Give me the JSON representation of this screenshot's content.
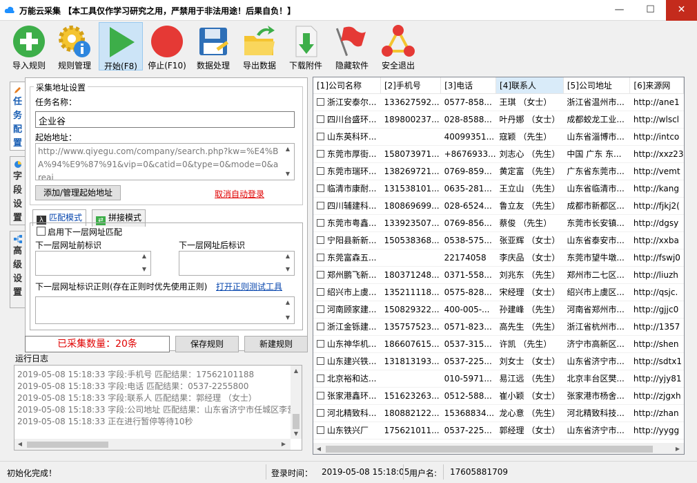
{
  "window": {
    "title": "万能云采集 【本工具仅作学习研究之用，严禁用于非法用途！后果自负！】",
    "minimize": "—",
    "maximize": "☐",
    "close": "✕"
  },
  "toolbar": {
    "import_rules": "导入规则",
    "rule_manage": "规则管理",
    "start": "开始(F8)",
    "stop": "停止(F10)",
    "data_process": "数据处理",
    "export_data": "导出数据",
    "download_attachments": "下载附件",
    "hide_software": "隐藏软件",
    "safe_exit": "安全退出"
  },
  "side_tabs": {
    "task_config": "任务配置",
    "field_settings": "字段设置",
    "advanced_settings": "高级设置"
  },
  "task_config": {
    "group_title": "采集地址设置",
    "task_name_label": "任务名称：",
    "task_name_value": "企业谷",
    "start_url_label": "起始地址：",
    "start_url_value": "http://www.qiyegu.com/company/search.php?kw=%E4%BA%94%E9%87%91&vip=0&catid=0&type=0&mode=0&areai",
    "add_manage_url_button": "添加/管理起始地址",
    "cancel_auto_login_link": "取消自动登录",
    "match_mode_tab": "匹配模式",
    "splice_mode_tab": "拼接模式",
    "enable_next_level_checkbox": "启用下一层网址匹配",
    "next_prefix_label": "下一层网址前标识",
    "next_suffix_label": "下一层网址后标识",
    "next_regex_label": "下一层网址标识正则(存在正则时优先使用正则)",
    "open_regex_tool_link": "打开正则测试工具"
  },
  "actions": {
    "collected_count": "已采集数量：20条",
    "save_rule": "保存规则",
    "new_rule": "新建规则"
  },
  "log": {
    "title": "运行日志",
    "lines": [
      "2019-05-08 15:18:33 字段:手机号 匹配结果：17562101188",
      "2019-05-08 15:18:33 字段:电话 匹配结果：0537-2255800",
      "2019-05-08 15:18:33 字段:联系人 匹配结果：郭经理 （女士）",
      "2019-05-08 15:18:33 字段:公司地址 匹配结果：山东省济宁市任城区李营",
      "2019-05-08 15:18:33 正在进行暂停等待10秒"
    ]
  },
  "table": {
    "columns": [
      "[1]公司名称",
      "[2]手机号",
      "[3]电话",
      "[4]联系人",
      "[5]公司地址",
      "[6]来源网"
    ],
    "rows": [
      [
        "浙江安泰尔...",
        "133627592...",
        "0577-858...",
        "王琪 （女士）",
        "浙江省温州市...",
        "http://ane1"
      ],
      [
        "四川台盛环...",
        "189800237...",
        "028-8588...",
        "叶丹娜 （女士）",
        "成都蛟龙工业...",
        "http://wlscl"
      ],
      [
        "山东英科环...",
        "",
        "40099351...",
        "寇颖 （先生）",
        "山东省淄博市...",
        "http://intco"
      ],
      [
        "东莞市厚街...",
        "158073971...",
        "+8676933...",
        "刘志心 （先生）",
        "中国 广东 东...",
        "http://xxz23"
      ],
      [
        "东莞市瑞环...",
        "138269721...",
        "0769-859...",
        "黄定富 （先生）",
        "广东省东莞市...",
        "http://vemt"
      ],
      [
        "临清市康耐...",
        "131538101...",
        "0635-281...",
        "王立山 （先生）",
        "山东省临清市...",
        "http://kang"
      ],
      [
        "四川辅建科...",
        "180869699...",
        "028-6524...",
        "鲁立友 （先生）",
        "成都市新都区...",
        "http://fjkj2("
      ],
      [
        "东莞市粤鑫...",
        "133923507...",
        "0769-856...",
        "蔡俊 （先生）",
        "东莞市长安镇...",
        "http://dgsy"
      ],
      [
        "宁阳县新新...",
        "150538368...",
        "0538-575...",
        "张亚辉 （女士）",
        "山东省泰安市...",
        "http://xxba"
      ],
      [
        "东莞富森五...",
        "",
        "22174058",
        "李庆品 （女士）",
        "东莞市望牛墩...",
        "http://fswj0"
      ],
      [
        "郑州鹏飞新...",
        "180371248...",
        "0371-558...",
        "刘兆东 （先生）",
        "郑州市二七区...",
        "http://liuzh"
      ],
      [
        "绍兴市上虞...",
        "135211118...",
        "0575-828...",
        "宋经理 （女士）",
        "绍兴市上虞区...",
        "http://qsjc."
      ],
      [
        "河南顾家建...",
        "150829322...",
        "400-005-...",
        "孙建峰 （先生）",
        "河南省郑州市...",
        "http://gjjc0"
      ],
      [
        "浙江金铄建...",
        "135757523...",
        "0571-823...",
        "高先生 （先生）",
        "浙江省杭州市...",
        "http://1357"
      ],
      [
        "山东神华机...",
        "186607615...",
        "0537-315...",
        "许凯 （先生）",
        "济宁市高新区...",
        "http://shen"
      ],
      [
        "山东建兴铁...",
        "131813193...",
        "0537-225...",
        "刘女士 （女士）",
        "山东省济宁市...",
        "http://sdtx1"
      ],
      [
        "北京裕和达...",
        "",
        "010-5971...",
        "易江远 （先生）",
        "北京丰台区樊...",
        "http://yjy81"
      ],
      [
        "张家港鑫环...",
        "151623263...",
        "0512-588...",
        "崔小颖 （女士）",
        "张家港市杨舍...",
        "http://zjgxh"
      ],
      [
        "河北精致科...",
        "180882122...",
        "15368834...",
        "龙心意 （先生）",
        "河北精致科技...",
        "http://zhan"
      ],
      [
        "山东铁兴厂",
        "175621011...",
        "0537-225...",
        "郭经理 （女士）",
        "山东省济宁市...",
        "http://yygg"
      ]
    ]
  },
  "status": {
    "message": "初始化完成！",
    "login_time_label": "登录时间：",
    "login_time_value": "2019-05-08 15:18:05",
    "user_label": "用户名:",
    "user_value": "17605881709"
  }
}
